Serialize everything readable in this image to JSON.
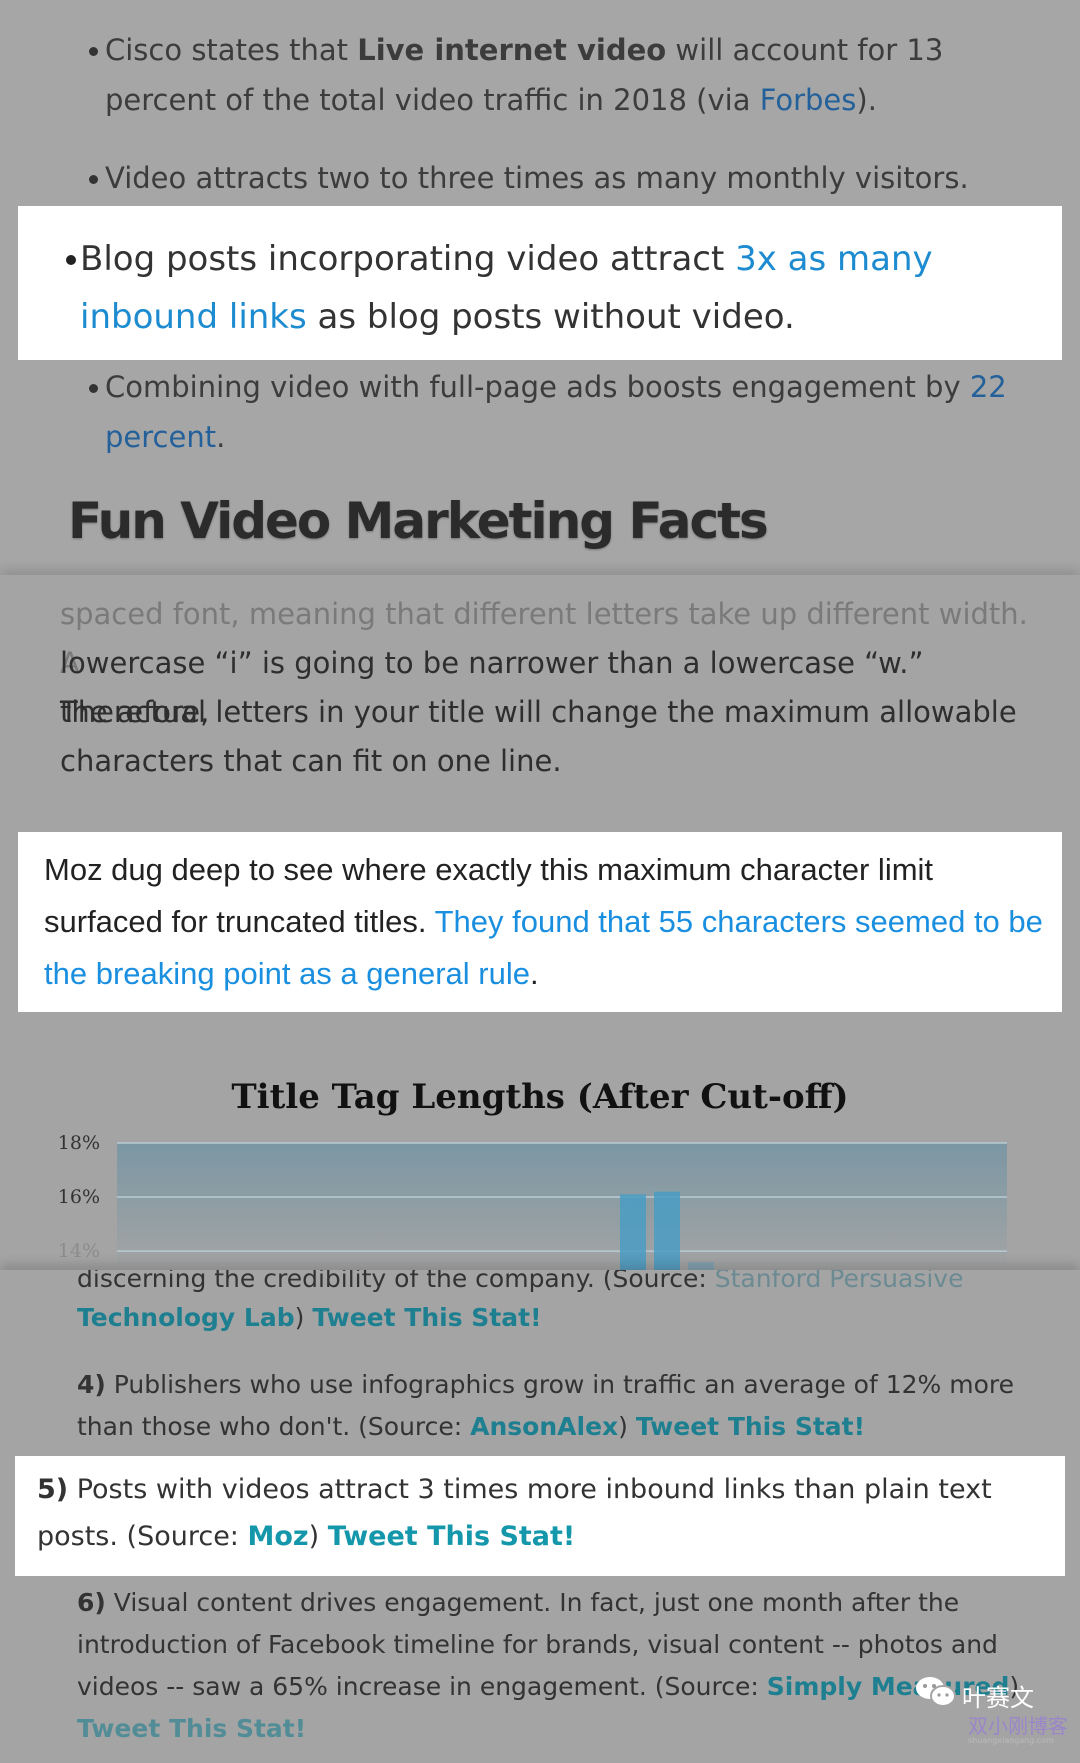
{
  "section1": {
    "bullets": [
      {
        "pre": "Cisco states that ",
        "bold": "Live internet video",
        "mid": " will account for 13 percent of the total video traffic in 2018 (via ",
        "link": "Forbes",
        "post": ")."
      },
      {
        "pre": "Video attracts two to three times as many monthly visitors."
      },
      {
        "pre": "Combining video with full-page ads boosts engagement by ",
        "link": "22 percent",
        "post": "."
      }
    ],
    "highlight": {
      "pre": "Blog posts incorporating video attract ",
      "link": "3x as many inbound links",
      "post": " as blog posts without video."
    },
    "heading": "Fun Video Marketing Facts"
  },
  "section2": {
    "faded_line": "spaced font, meaning that different letters take up different width. A",
    "lines": [
      "lowercase “i” is going to be narrower than a lowercase “w.” Therefore,",
      "the actual letters in your title will change the maximum allowable",
      "characters that can fit on one line."
    ],
    "highlight": {
      "pre": "Moz dug deep to see where exactly this maximum character limit surfaced for truncated titles. ",
      "link": "They found that 55 characters seemed to be the breaking point as a general rule",
      "post": "."
    }
  },
  "chart_data": {
    "type": "bar",
    "title": "Title Tag Lengths (After Cut-off)",
    "yticks": [
      "18%",
      "16%",
      "14%"
    ],
    "ylim": [
      13.3,
      18
    ],
    "values": [
      16.1,
      16.2,
      13.6
    ],
    "color": "#4a9cc4"
  },
  "section3": {
    "faded_line": {
      "pre": "discerning the credibility of the company. (Source: ",
      "link": "Stanford Persuasive"
    },
    "line1": {
      "link": "Technology Lab",
      "post": ") ",
      "tweet": "Tweet This Stat!"
    },
    "item4": {
      "num": "4)",
      "text": " Publishers who use infographics grow in traffic an average of 12% more than those who don't. (Source: ",
      "link": "AnsonAlex",
      "post": ") ",
      "tweet": "Tweet This Stat!"
    },
    "item5": {
      "num": "5)",
      "text": " Posts with videos attract 3 times more inbound links than plain text posts. (Source: ",
      "link": "Moz",
      "post": ") ",
      "tweet": "Tweet This Stat!"
    },
    "item6": {
      "num": "6)",
      "text": " Visual content drives engagement. In fact, just one month after the introduction of Facebook timeline for brands, visual content -- photos and videos -- saw a 65% increase in engagement. (Source: ",
      "link": "Simply Measured",
      "post": ")",
      "tweet": "Tweet This Stat!"
    }
  },
  "watermark": {
    "wechat": "叶赛文",
    "blog": "双小刚博客",
    "site": "shuangxiaogang.com"
  }
}
